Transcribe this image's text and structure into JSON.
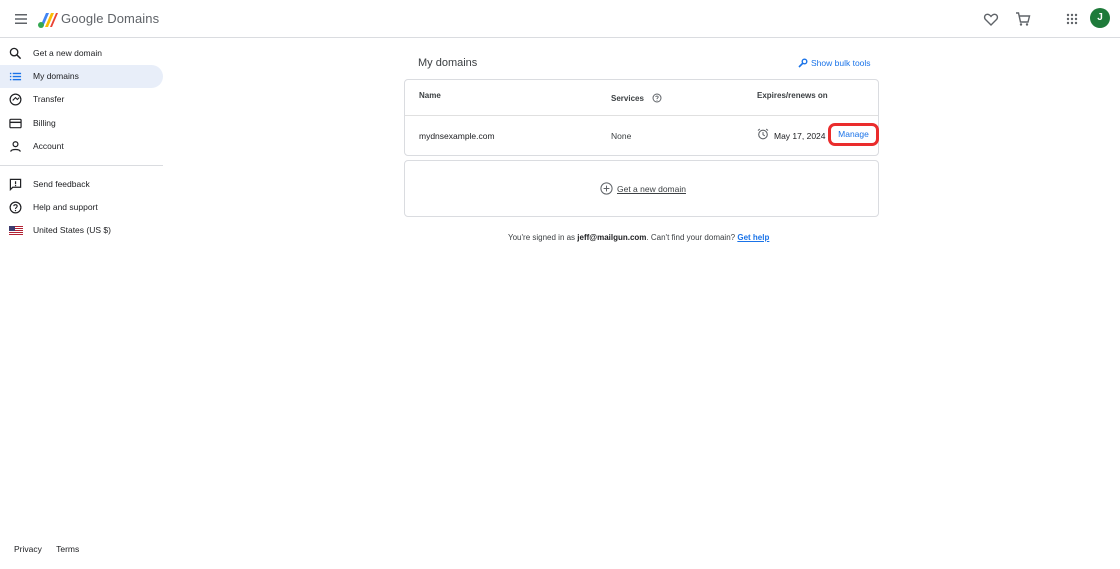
{
  "header": {
    "brand": "Google Domains",
    "avatar_initial": "J"
  },
  "sidebar": {
    "items": [
      {
        "label": "Get a new domain",
        "icon": "search-icon"
      },
      {
        "label": "My domains",
        "icon": "list-icon",
        "active": true
      },
      {
        "label": "Transfer",
        "icon": "transfer-icon"
      },
      {
        "label": "Billing",
        "icon": "credit-card-icon"
      },
      {
        "label": "Account",
        "icon": "person-icon"
      }
    ],
    "secondary": [
      {
        "label": "Send feedback",
        "icon": "feedback-icon"
      },
      {
        "label": "Help and support",
        "icon": "help-icon"
      },
      {
        "label": "United States (US $)",
        "icon": "us-flag-icon"
      }
    ]
  },
  "footer": {
    "privacy": "Privacy",
    "terms": "Terms"
  },
  "main": {
    "title": "My domains",
    "bulk_tools": "Show bulk tools",
    "table": {
      "headers": {
        "name": "Name",
        "services": "Services",
        "expires": "Expires/renews on"
      },
      "rows": [
        {
          "name": "mydnsexample.com",
          "services": "None",
          "expires": "May 17, 2024",
          "action": "Manage"
        }
      ]
    },
    "new_domain": "Get a new domain",
    "signed_in": {
      "prefix": "You're signed in as ",
      "email": "jeff@mailgun.com",
      "middle": ". Can't find your domain? ",
      "help": "Get help"
    }
  },
  "colors": {
    "accent": "#1a73e8",
    "highlight": "#ea2c2c",
    "active_nav": "#e8eef9",
    "avatar": "#1e7a3a"
  }
}
